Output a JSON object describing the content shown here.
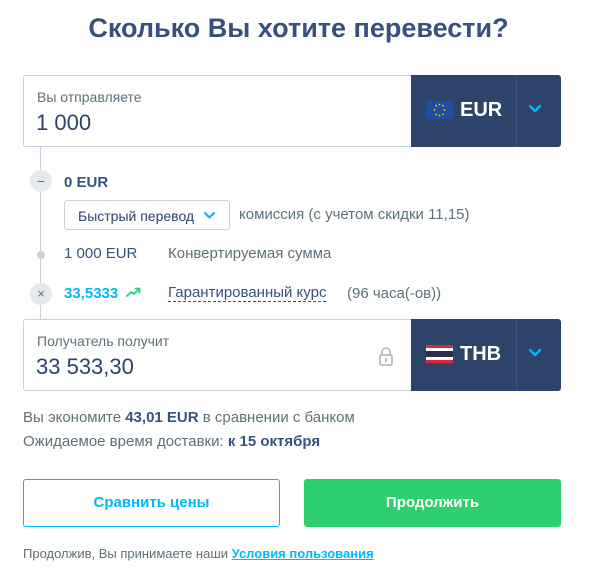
{
  "title": "Сколько Вы хотите перевести?",
  "send": {
    "label": "Вы отправляете",
    "amount": "1 000",
    "currency": "EUR",
    "flag_icon": "eu-flag-icon"
  },
  "fees": {
    "fee_amount": "0 EUR",
    "delivery_option": "Быстрый перевод",
    "fee_label": "комиссия (с учетом скидки 11,15)",
    "converted_amount": "1 000 EUR",
    "converted_label": "Конвертируемая сумма",
    "rate": "33,5333",
    "rate_label": "Гарантированный курс",
    "rate_hours": "(96 часа(-ов))"
  },
  "receive": {
    "label": "Получатель получит",
    "amount": "33 533,30",
    "currency": "THB",
    "flag_icon": "thailand-flag-icon"
  },
  "savings": {
    "prefix": "Вы экономите",
    "amount": "43,01 EUR",
    "suffix": "в сравнении с банком"
  },
  "delivery": {
    "prefix": "Ожидаемое время доставки:",
    "date": "к 15 октября"
  },
  "buttons": {
    "compare": "Сравнить цены",
    "continue": "Продолжить"
  },
  "terms": {
    "prefix": "Продолжив, Вы принимаете наши",
    "link": "Условия пользования"
  },
  "colors": {
    "navy": "#2e4369",
    "text": "#37517e",
    "accent_blue": "#00b9ff",
    "green": "#2ed06e"
  }
}
